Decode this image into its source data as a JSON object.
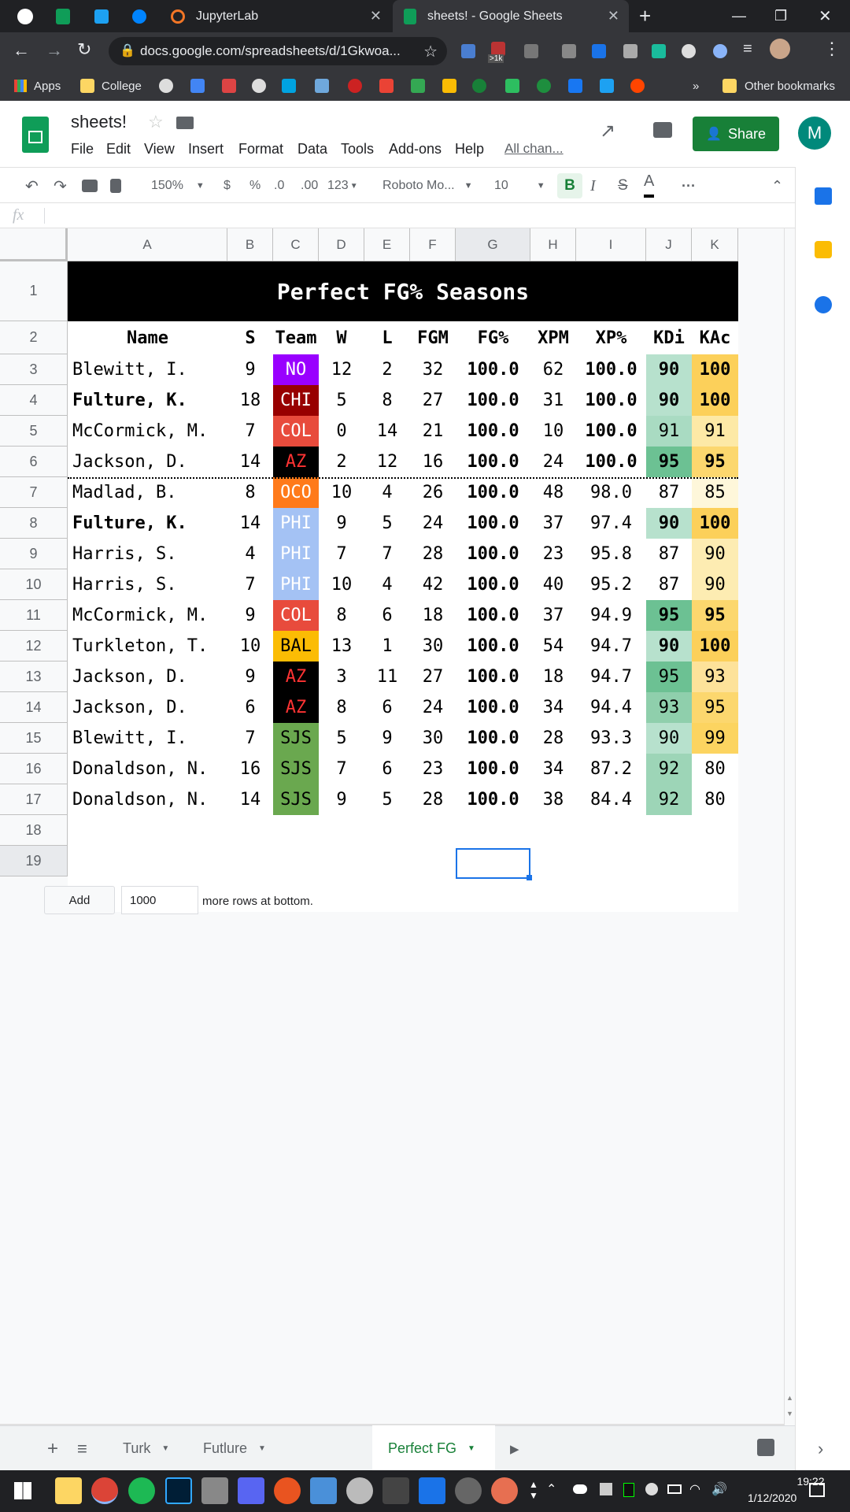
{
  "browser": {
    "tabs": [
      {
        "label": "JupyterLab"
      },
      {
        "label": "sheets! - Google Sheets"
      }
    ],
    "url": "docs.google.com/spreadsheets/d/1Gkwoa...",
    "ext_badge": ">1k",
    "bookmarks": {
      "apps": "Apps",
      "college": "College",
      "other": "Other bookmarks",
      "more": "»"
    }
  },
  "doc": {
    "title": "sheets!",
    "menus": [
      "File",
      "Edit",
      "View",
      "Insert",
      "Format",
      "Data",
      "Tools",
      "Add-ons",
      "Help"
    ],
    "last_edit": "All chan...",
    "share_label": "Share",
    "avatar_letter": "M"
  },
  "toolbar": {
    "zoom": "150%",
    "currency": "$",
    "percent": "%",
    "dec_dec": ".0",
    "dec_inc": ".00",
    "more_formats": "123",
    "font": "Roboto Mo...",
    "font_size": "10",
    "bold": "B",
    "italic": "I",
    "strike": "S",
    "text_color": "A",
    "more": "···"
  },
  "formula_bar": {
    "fx": "fx",
    "value": ""
  },
  "columns": [
    "A",
    "B",
    "C",
    "D",
    "E",
    "F",
    "G",
    "H",
    "I",
    "J",
    "K"
  ],
  "row_numbers": [
    "1",
    "2",
    "3",
    "4",
    "5",
    "6",
    "7",
    "8",
    "9",
    "10",
    "11",
    "12",
    "13",
    "14",
    "15",
    "16",
    "17",
    "18",
    "19"
  ],
  "sheet": {
    "title": "Perfect FG% Seasons",
    "headers": [
      "Name",
      "S",
      "Team",
      "W",
      "L",
      "FGM",
      "FG%",
      "XPM",
      "XP%",
      "KDi",
      "KAc"
    ],
    "rows": [
      {
        "name": "Blewitt, I.",
        "s": "9",
        "team": "NO",
        "w": "12",
        "l": "2",
        "fgm": "32",
        "fgp": "100.0",
        "xpm": "62",
        "xpp": "100.0",
        "kdi": "90",
        "kac": "100",
        "bold_name": false,
        "team_bg": "#9900ff",
        "team_fg": "#ffffff",
        "kdi_bg": "#b7e1cd",
        "kac_bg": "#fcd05a",
        "bold_k": true,
        "bold_xp": true
      },
      {
        "name": "Fulture, K.",
        "s": "18",
        "team": "CHI",
        "w": "5",
        "l": "8",
        "fgm": "27",
        "fgp": "100.0",
        "xpm": "31",
        "xpp": "100.0",
        "kdi": "90",
        "kac": "100",
        "bold_name": true,
        "team_bg": "#980000",
        "team_fg": "#ffffff",
        "kdi_bg": "#b7e1cd",
        "kac_bg": "#fcd05a",
        "bold_k": true,
        "bold_xp": true
      },
      {
        "name": "McCormick, M.",
        "s": "7",
        "team": "COL",
        "w": "0",
        "l": "14",
        "fgm": "21",
        "fgp": "100.0",
        "xpm": "10",
        "xpp": "100.0",
        "kdi": "91",
        "kac": "91",
        "bold_name": false,
        "team_bg": "#e84b3c",
        "team_fg": "#ffffff",
        "kdi_bg": "#a9dbc2",
        "kac_bg": "#fde9a6",
        "bold_k": false,
        "bold_xp": true
      },
      {
        "name": "Jackson, D.",
        "s": "14",
        "team": "AZ",
        "w": "2",
        "l": "12",
        "fgm": "16",
        "fgp": "100.0",
        "xpm": "24",
        "xpp": "100.0",
        "kdi": "95",
        "kac": "95",
        "bold_name": false,
        "team_bg": "#000000",
        "team_fg": "#ff3333",
        "kdi_bg": "#6cc193",
        "kac_bg": "#fcd76e",
        "bold_k": true,
        "bold_xp": true
      },
      {
        "name": "Madlad, B.",
        "s": "8",
        "team": "OCO",
        "w": "10",
        "l": "4",
        "fgm": "26",
        "fgp": "100.0",
        "xpm": "48",
        "xpp": "98.0",
        "kdi": "87",
        "kac": "85",
        "bold_name": false,
        "team_bg": "#ff7a1a",
        "team_fg": "#ffffff",
        "kdi_bg": "#ffffff",
        "kac_bg": "#fef7da",
        "bold_k": false,
        "bold_xp": false
      },
      {
        "name": "Fulture, K.",
        "s": "14",
        "team": "PHI",
        "w": "9",
        "l": "5",
        "fgm": "24",
        "fgp": "100.0",
        "xpm": "37",
        "xpp": "97.4",
        "kdi": "90",
        "kac": "100",
        "bold_name": true,
        "team_bg": "#a4c2f4",
        "team_fg": "#ffffff",
        "kdi_bg": "#b7e1cd",
        "kac_bg": "#fcd05a",
        "bold_k": true,
        "bold_xp": false
      },
      {
        "name": "Harris, S.",
        "s": "4",
        "team": "PHI",
        "w": "7",
        "l": "7",
        "fgm": "28",
        "fgp": "100.0",
        "xpm": "23",
        "xpp": "95.8",
        "kdi": "87",
        "kac": "90",
        "bold_name": false,
        "team_bg": "#a4c2f4",
        "team_fg": "#ffffff",
        "kdi_bg": "#ffffff",
        "kac_bg": "#fdecb2",
        "bold_k": false,
        "bold_xp": false
      },
      {
        "name": "Harris, S.",
        "s": "7",
        "team": "PHI",
        "w": "10",
        "l": "4",
        "fgm": "42",
        "fgp": "100.0",
        "xpm": "40",
        "xpp": "95.2",
        "kdi": "87",
        "kac": "90",
        "bold_name": false,
        "team_bg": "#a4c2f4",
        "team_fg": "#ffffff",
        "kdi_bg": "#ffffff",
        "kac_bg": "#fdecb2",
        "bold_k": false,
        "bold_xp": false
      },
      {
        "name": "McCormick, M.",
        "s": "9",
        "team": "COL",
        "w": "8",
        "l": "6",
        "fgm": "18",
        "fgp": "100.0",
        "xpm": "37",
        "xpp": "94.9",
        "kdi": "95",
        "kac": "95",
        "bold_name": false,
        "team_bg": "#e84b3c",
        "team_fg": "#ffffff",
        "kdi_bg": "#6cc193",
        "kac_bg": "#fcd76e",
        "bold_k": true,
        "bold_xp": false
      },
      {
        "name": "Turkleton, T.",
        "s": "10",
        "team": "BAL",
        "w": "13",
        "l": "1",
        "fgm": "30",
        "fgp": "100.0",
        "xpm": "54",
        "xpp": "94.7",
        "kdi": "90",
        "kac": "100",
        "bold_name": false,
        "team_bg": "#fbbc04",
        "team_fg": "#000000",
        "kdi_bg": "#b7e1cd",
        "kac_bg": "#fcd05a",
        "bold_k": true,
        "bold_xp": false
      },
      {
        "name": "Jackson, D.",
        "s": "9",
        "team": "AZ",
        "w": "3",
        "l": "11",
        "fgm": "27",
        "fgp": "100.0",
        "xpm": "18",
        "xpp": "94.7",
        "kdi": "95",
        "kac": "93",
        "bold_name": false,
        "team_bg": "#000000",
        "team_fg": "#ff3333",
        "kdi_bg": "#6cc193",
        "kac_bg": "#fde29a",
        "bold_k": false,
        "bold_xp": false
      },
      {
        "name": "Jackson, D.",
        "s": "6",
        "team": "AZ",
        "w": "8",
        "l": "6",
        "fgm": "24",
        "fgp": "100.0",
        "xpm": "34",
        "xpp": "94.4",
        "kdi": "93",
        "kac": "95",
        "bold_name": false,
        "team_bg": "#000000",
        "team_fg": "#ff3333",
        "kdi_bg": "#8fcfac",
        "kac_bg": "#fcd76e",
        "bold_k": false,
        "bold_xp": false
      },
      {
        "name": "Blewitt, I.",
        "s": "7",
        "team": "SJS",
        "w": "5",
        "l": "9",
        "fgm": "30",
        "fgp": "100.0",
        "xpm": "28",
        "xpp": "93.3",
        "kdi": "90",
        "kac": "99",
        "bold_name": false,
        "team_bg": "#6aa84f",
        "team_fg": "#000000",
        "kdi_bg": "#b7e1cd",
        "kac_bg": "#fcd460",
        "bold_k": false,
        "bold_xp": false
      },
      {
        "name": "Donaldson, N.",
        "s": "16",
        "team": "SJS",
        "w": "7",
        "l": "6",
        "fgm": "23",
        "fgp": "100.0",
        "xpm": "34",
        "xpp": "87.2",
        "kdi": "92",
        "kac": "80",
        "bold_name": false,
        "team_bg": "#6aa84f",
        "team_fg": "#000000",
        "kdi_bg": "#9dd5b7",
        "kac_bg": "#ffffff",
        "bold_k": false,
        "bold_xp": false
      },
      {
        "name": "Donaldson, N.",
        "s": "14",
        "team": "SJS",
        "w": "9",
        "l": "5",
        "fgm": "28",
        "fgp": "100.0",
        "xpm": "38",
        "xpp": "84.4",
        "kdi": "92",
        "kac": "80",
        "bold_name": false,
        "team_bg": "#6aa84f",
        "team_fg": "#000000",
        "kdi_bg": "#9dd5b7",
        "kac_bg": "#ffffff",
        "bold_k": false,
        "bold_xp": false
      }
    ]
  },
  "add_rows": {
    "button": "Add",
    "count": "1000",
    "suffix": "more rows at bottom."
  },
  "sheet_tabs": [
    {
      "label": "Turk",
      "active": false
    },
    {
      "label": "Futlure",
      "active": false
    },
    {
      "label": "Perfect FG",
      "active": true
    }
  ],
  "taskbar": {
    "time": "19:22",
    "date": "1/12/2020"
  },
  "colors": {
    "accent_green": "#188038",
    "selection_blue": "#1a73e8",
    "chrome_dark": "#202124"
  }
}
